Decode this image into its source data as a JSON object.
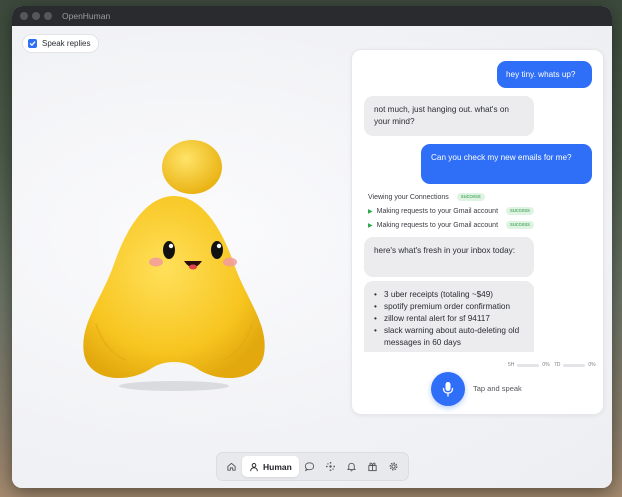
{
  "window": {
    "title": "OpenHuman"
  },
  "speak_replies": {
    "label": "Speak replies",
    "checked": true
  },
  "chat": {
    "messages": [
      {
        "role": "user",
        "text": "hey tiny. whats up?"
      },
      {
        "role": "bot",
        "text": "not much, just hanging out. what's on your mind?"
      },
      {
        "role": "user",
        "text": "Can you check my new emails for me?"
      }
    ],
    "tools": [
      {
        "label": "Viewing your Connections",
        "status": "success"
      },
      {
        "label": "Making requests to your Gmail account",
        "status": "success"
      },
      {
        "label": "Making requests to your Gmail account",
        "status": "success"
      }
    ],
    "reply_intro": "here's what's fresh in your inbox today:",
    "reply_items": [
      "3 uber receipts (totaling ~$49)",
      "spotify premium order confirmation",
      "zillow rental alert for sf 94117",
      "slack warning about auto-deleting old messages in 60 days"
    ]
  },
  "stats": [
    {
      "label": "5H",
      "value": "0%",
      "fraction": 0
    },
    {
      "label": "7D",
      "value": "0%",
      "fraction": 0
    }
  ],
  "voice": {
    "tap_label": "Tap and speak"
  },
  "nav": {
    "active_label": "Human"
  },
  "colors": {
    "accent": "#2f6ef7",
    "mascot": "#f7c520",
    "success": "#2f9c4a"
  }
}
